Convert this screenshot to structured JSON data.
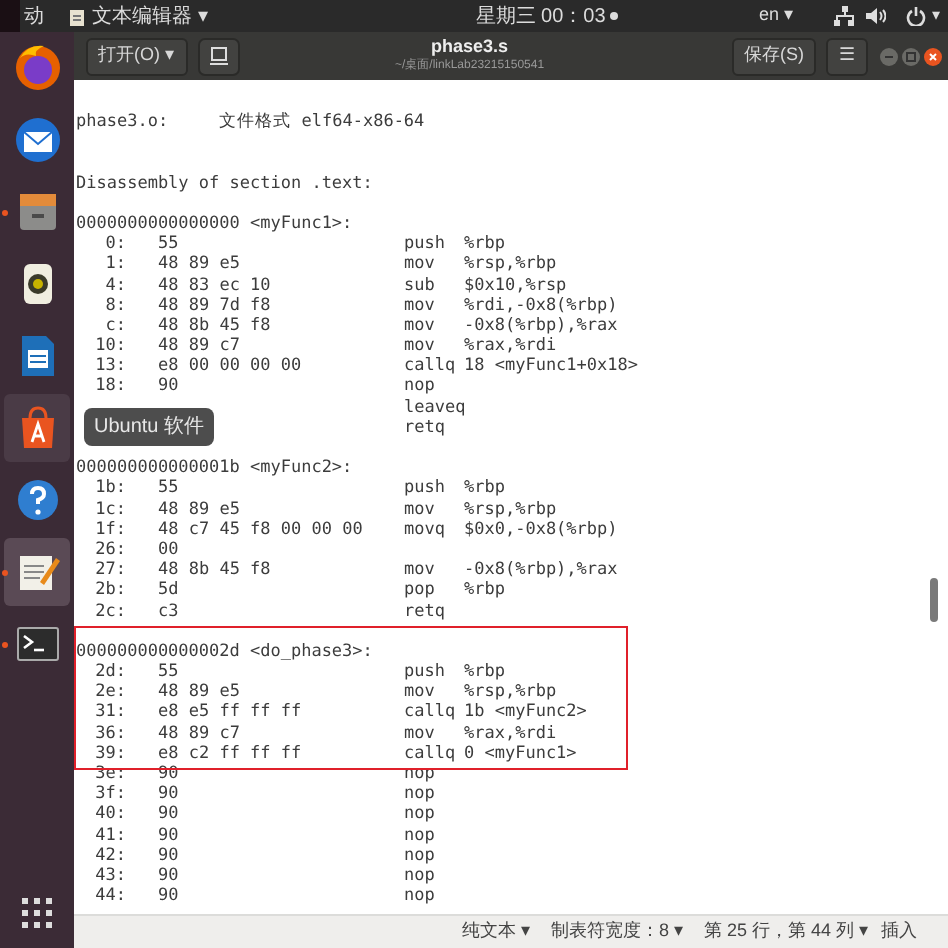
{
  "top_bar": {
    "activities": "动",
    "app_menu": "文本编辑器 ▾",
    "clock": "星期三 00：03",
    "language": "en ▾",
    "system_caret": "▾"
  },
  "dock": {
    "items": [
      {
        "kind": "firefox",
        "running": false,
        "selected": false,
        "hovered": false
      },
      {
        "kind": "mail",
        "running": false,
        "selected": false,
        "hovered": false
      },
      {
        "kind": "files",
        "running": true,
        "selected": false,
        "hovered": false
      },
      {
        "kind": "music",
        "running": false,
        "selected": false,
        "hovered": false
      },
      {
        "kind": "writer",
        "running": false,
        "selected": false,
        "hovered": false
      },
      {
        "kind": "software",
        "running": false,
        "selected": false,
        "hovered": true
      },
      {
        "kind": "help",
        "running": false,
        "selected": false,
        "hovered": false
      },
      {
        "kind": "editor",
        "running": true,
        "selected": true,
        "hovered": false
      },
      {
        "kind": "terminal",
        "running": true,
        "selected": false,
        "hovered": false
      }
    ],
    "tooltip": "Ubuntu 软件"
  },
  "header_bar": {
    "open_button": "打开(O) ▾",
    "title": "phase3.s",
    "subtitle": "~/桌面/linkLab23215150541",
    "save_button": "保存(S)",
    "menu_button": "☰"
  },
  "editor": {
    "blocks": [
      {
        "highlighted": false,
        "lines": [
          {
            "kind": "text",
            "text": "phase3.o:     文件格式 elf64-x86-64"
          },
          {
            "kind": "blank"
          },
          {
            "kind": "blank"
          },
          {
            "kind": "text",
            "text": "Disassembly of section .text:"
          },
          {
            "kind": "blank"
          },
          {
            "kind": "text",
            "text": "0000000000000000 <myFunc1>:"
          },
          {
            "kind": "instr",
            "addr": "0:",
            "bytes": "55",
            "op": "push",
            "args": "%rbp"
          },
          {
            "kind": "instr",
            "addr": "1:",
            "bytes": "48 89 e5",
            "op": "mov",
            "args": "%rsp,%rbp"
          },
          {
            "kind": "instr",
            "addr": "4:",
            "bytes": "48 83 ec 10",
            "op": "sub",
            "args": "$0x10,%rsp"
          },
          {
            "kind": "instr",
            "addr": "8:",
            "bytes": "48 89 7d f8",
            "op": "mov",
            "args": "%rdi,-0x8(%rbp)"
          },
          {
            "kind": "instr",
            "addr": "c:",
            "bytes": "48 8b 45 f8",
            "op": "mov",
            "args": "-0x8(%rbp),%rax"
          },
          {
            "kind": "instr",
            "addr": "10:",
            "bytes": "48 89 c7",
            "op": "mov",
            "args": "%rax,%rdi"
          },
          {
            "kind": "instr",
            "addr": "13:",
            "bytes": "e8 00 00 00 00",
            "op": "callq",
            "args": "18 <myFunc1+0x18>"
          },
          {
            "kind": "instr",
            "addr": "18:",
            "bytes": "90",
            "op": "nop"
          },
          {
            "kind": "instr",
            "op": "leaveq"
          },
          {
            "kind": "instr",
            "op": "retq"
          },
          {
            "kind": "blank"
          },
          {
            "kind": "text",
            "text": "000000000000001b <myFunc2>:"
          },
          {
            "kind": "instr",
            "addr": "1b:",
            "bytes": "55",
            "op": "push",
            "args": "%rbp"
          },
          {
            "kind": "instr",
            "addr": "1c:",
            "bytes": "48 89 e5",
            "op": "mov",
            "args": "%rsp,%rbp"
          },
          {
            "kind": "instr",
            "addr": "1f:",
            "bytes": "48 c7 45 f8 00 00 00",
            "op": "movq",
            "args": "$0x0,-0x8(%rbp)"
          },
          {
            "kind": "instr",
            "addr": "26:",
            "bytes": "00"
          },
          {
            "kind": "instr",
            "addr": "27:",
            "bytes": "48 8b 45 f8",
            "op": "mov",
            "args": "-0x8(%rbp),%rax"
          },
          {
            "kind": "instr",
            "addr": "2b:",
            "bytes": "5d",
            "op": "pop",
            "args": "%rbp"
          },
          {
            "kind": "instr",
            "addr": "2c:",
            "bytes": "c3",
            "op": "retq"
          }
        ]
      },
      {
        "highlighted": true,
        "lines": [
          {
            "kind": "blank"
          },
          {
            "kind": "text",
            "text": "000000000000002d <do_phase3>:"
          },
          {
            "kind": "instr",
            "addr": "2d:",
            "bytes": "55",
            "op": "push",
            "args": "%rbp"
          },
          {
            "kind": "instr",
            "addr": "2e:",
            "bytes": "48 89 e5",
            "op": "mov",
            "args": "%rsp,%rbp"
          },
          {
            "kind": "instr",
            "addr": "31:",
            "bytes": "e8 e5 ff ff ff",
            "op": "callq",
            "args": "1b <myFunc2>"
          },
          {
            "kind": "instr",
            "addr": "36:",
            "bytes": "48 89 c7",
            "op": "mov",
            "args": "%rax,%rdi"
          },
          {
            "kind": "instr",
            "addr": "39:",
            "bytes": "e8 c2 ff ff ff",
            "op": "callq",
            "args": "0 <myFunc1>"
          }
        ]
      },
      {
        "highlighted": false,
        "lines": [
          {
            "kind": "instr",
            "addr": "3e:",
            "bytes": "90",
            "op": "nop"
          },
          {
            "kind": "instr",
            "addr": "3f:",
            "bytes": "90",
            "op": "nop"
          },
          {
            "kind": "instr",
            "addr": "40:",
            "bytes": "90",
            "op": "nop"
          },
          {
            "kind": "instr",
            "addr": "41:",
            "bytes": "90",
            "op": "nop"
          },
          {
            "kind": "instr",
            "addr": "42:",
            "bytes": "90",
            "op": "nop"
          },
          {
            "kind": "instr",
            "addr": "43:",
            "bytes": "90",
            "op": "nop"
          },
          {
            "kind": "instr",
            "addr": "44:",
            "bytes": "90",
            "op": "nop"
          }
        ]
      }
    ]
  },
  "status_bar": {
    "language": "纯文本 ▾",
    "tab_width": "制表符宽度：8 ▾",
    "position": "第 25 行，第 44 列 ▾",
    "mode": "插入"
  }
}
